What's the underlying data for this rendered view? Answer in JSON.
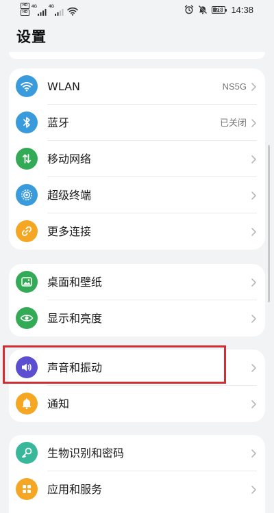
{
  "status_bar": {
    "sim_badge_1": "HD",
    "sim_badge_2": "HD",
    "signal_1_type": "4G",
    "signal_2_type": "4G",
    "icons": [
      "hd-icon",
      "signal-icon",
      "signal-icon",
      "wifi-icon",
      "alarm-icon",
      "mute-icon",
      "battery-icon"
    ],
    "battery_level": "78",
    "time": "14:38"
  },
  "header": {
    "title": "设置"
  },
  "groups": [
    {
      "items": [
        {
          "label": "WLAN",
          "value": "NS5G",
          "icon": "wifi-icon",
          "color": "#3a9bdc"
        },
        {
          "label": "蓝牙",
          "value": "已关闭",
          "icon": "bluetooth-icon",
          "color": "#3a9bdc"
        },
        {
          "label": "移动网络",
          "value": "",
          "icon": "mobile-data-icon",
          "color": "#33aa55"
        },
        {
          "label": "超级终端",
          "value": "",
          "icon": "super-device-icon",
          "color": "#3a9bdc"
        },
        {
          "label": "更多连接",
          "value": "",
          "icon": "link-icon",
          "color": "#f5a623"
        }
      ]
    },
    {
      "items": [
        {
          "label": "桌面和壁纸",
          "value": "",
          "icon": "wallpaper-icon",
          "color": "#33aa55"
        },
        {
          "label": "显示和亮度",
          "value": "",
          "icon": "eye-icon",
          "color": "#33aa55"
        }
      ]
    },
    {
      "items": [
        {
          "label": "声音和振动",
          "value": "",
          "icon": "speaker-icon",
          "color": "#5b4ed1"
        },
        {
          "label": "通知",
          "value": "",
          "icon": "bell-icon",
          "color": "#f5a623"
        }
      ]
    },
    {
      "items": [
        {
          "label": "生物识别和密码",
          "value": "",
          "icon": "key-icon",
          "color": "#39b79a"
        },
        {
          "label": "应用和服务",
          "value": "",
          "icon": "apps-icon",
          "color": "#f5a623"
        }
      ]
    }
  ],
  "highlight": {
    "target": "声音和振动",
    "color": "#d32d34"
  }
}
